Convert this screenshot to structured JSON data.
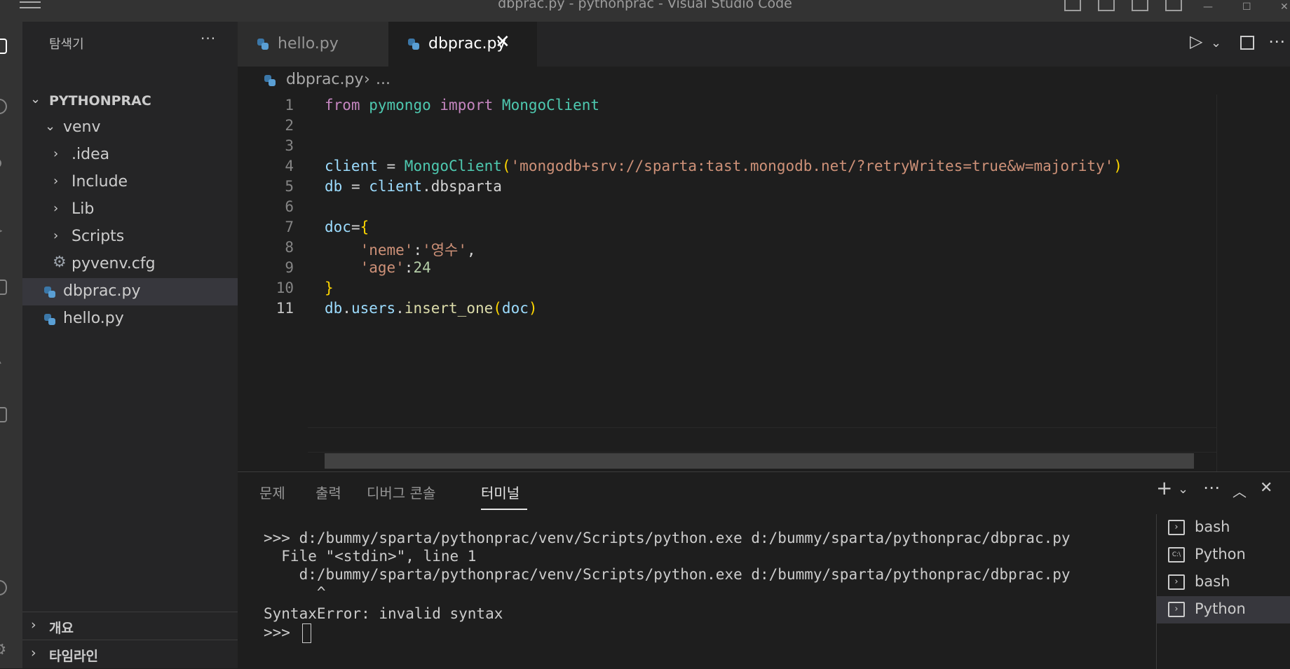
{
  "window": {
    "title": "dbprac.py - pythonprac - Visual Studio Code"
  },
  "sidebar": {
    "title": "탐색기",
    "more": "···",
    "root": "PYTHONPRAC",
    "items": [
      {
        "label": "venv"
      },
      {
        "label": ".idea"
      },
      {
        "label": "Include"
      },
      {
        "label": "Lib"
      },
      {
        "label": "Scripts"
      },
      {
        "label": "pyvenv.cfg"
      },
      {
        "label": "dbprac.py"
      },
      {
        "label": "hello.py"
      }
    ],
    "sections": [
      {
        "label": "개요"
      },
      {
        "label": "타임라인"
      }
    ]
  },
  "tabs": [
    {
      "label": "hello.py",
      "active": false
    },
    {
      "label": "dbprac.py",
      "active": true
    }
  ],
  "breadcrumb": {
    "file": "dbprac.py",
    "more": "..."
  },
  "editor": {
    "line_numbers": [
      "1",
      "2",
      "3",
      "4",
      "5",
      "6",
      "7",
      "8",
      "9",
      "10",
      "11"
    ],
    "current_line": 11,
    "code": {
      "l1": {
        "k1": "from",
        "m1": "pymongo",
        "k2": "import",
        "m2": "MongoClient"
      },
      "l4": {
        "v": "client",
        "op": " = ",
        "cls": "MongoClient",
        "s": "'mongodb+srv://sparta:tast.mongodb.net/?retryWrites=true&w=majority'"
      },
      "l5": {
        "v": "db",
        "op": " = ",
        "obj": "client",
        "attr": ".dbsparta"
      },
      "l7": {
        "v": "doc",
        "op": "=",
        "b": "{"
      },
      "l8": {
        "key": "'neme'",
        "colon": ":",
        "val": "'영수'",
        "comma": ","
      },
      "l9": {
        "key": "'age'",
        "colon": ":",
        "num": "24"
      },
      "l10": {
        "b": "}"
      },
      "l11": {
        "obj": "db",
        "p1": ".",
        "a1": "users",
        "p2": ".",
        "fn": "insert_one",
        "arg": "doc"
      }
    }
  },
  "panel": {
    "tabs": [
      {
        "label": "문제"
      },
      {
        "label": "출력"
      },
      {
        "label": "디버그 콘솔"
      },
      {
        "label": "터미널"
      }
    ],
    "active_tab": "터미널",
    "terminal_lines": [
      ">>> d:/bummy/sparta/pythonprac/venv/Scripts/python.exe d:/bummy/sparta/pythonprac/dbprac.py",
      "  File \"<stdin>\", line 1",
      "    d:/bummy/sparta/pythonprac/venv/Scripts/python.exe d:/bummy/sparta/pythonprac/dbprac.py",
      "      ^",
      "SyntaxError: invalid syntax"
    ],
    "prompt": ">>> ",
    "terminals": [
      {
        "label": "bash",
        "icon": "terminal-icon"
      },
      {
        "label": "Python",
        "icon": "cmd-icon"
      },
      {
        "label": "bash",
        "icon": "terminal-icon"
      },
      {
        "label": "Python",
        "icon": "terminal-icon"
      }
    ]
  }
}
